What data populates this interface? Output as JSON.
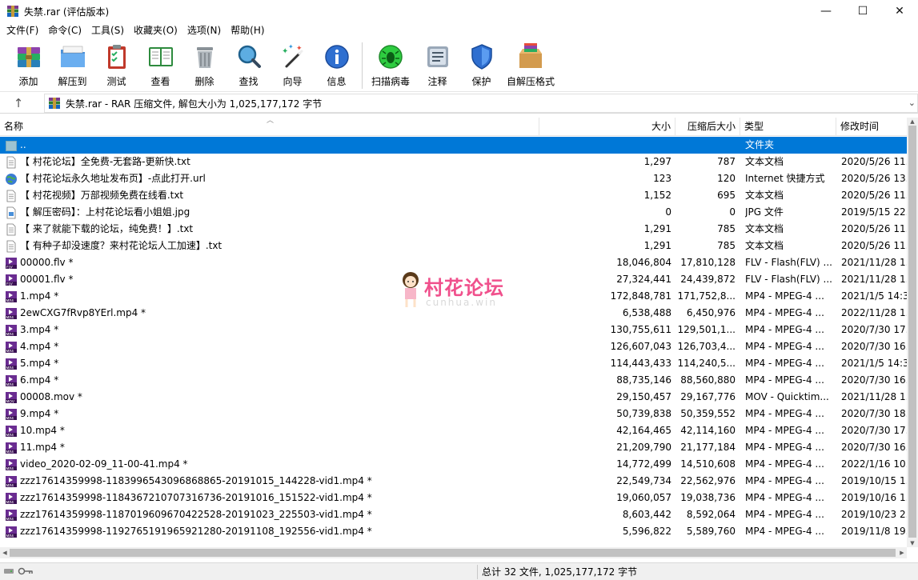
{
  "window": {
    "title": "失禁.rar (评估版本)",
    "minimize": "—",
    "maximize": "☐",
    "close": "✕"
  },
  "menu": [
    "文件(F)",
    "命令(C)",
    "工具(S)",
    "收藏夹(O)",
    "选项(N)",
    "帮助(H)"
  ],
  "toolbar": {
    "add": "添加",
    "extract_to": "解压到",
    "test": "测试",
    "view": "查看",
    "delete": "删除",
    "find": "查找",
    "wizard": "向导",
    "info": "信息",
    "virus_scan": "扫描病毒",
    "comment": "注释",
    "protect": "保护",
    "sfx": "自解压格式"
  },
  "address": {
    "text": "失禁.rar - RAR 压缩文件, 解包大小为 1,025,177,172 字节"
  },
  "columns": {
    "name": "名称",
    "size": "大小",
    "packed": "压缩后大小",
    "type": "类型",
    "modified": "修改时间"
  },
  "rows": [
    {
      "name": "..",
      "size": "",
      "packed": "",
      "type": "文件夹",
      "modified": "",
      "icon": "folder-up-icon"
    },
    {
      "name": "【 村花论坛】全免费-无套路-更新快.txt",
      "size": "1,297",
      "packed": "787",
      "type": "文本文档",
      "modified": "2020/5/26 11.",
      "icon": "text-file-icon"
    },
    {
      "name": "【 村花论坛永久地址发布页】-点此打开.url",
      "size": "123",
      "packed": "120",
      "type": "Internet 快捷方式",
      "modified": "2020/5/26 13.",
      "icon": "url-globe-icon"
    },
    {
      "name": "【 村花视频】万部视频免费在线看.txt",
      "size": "1,152",
      "packed": "695",
      "type": "文本文档",
      "modified": "2020/5/26 11.",
      "icon": "text-file-icon"
    },
    {
      "name": "【 解压密码】：上村花论坛看小姐姐.jpg",
      "size": "0",
      "packed": "0",
      "type": "JPG 文件",
      "modified": "2019/5/15 22.",
      "icon": "image-file-icon"
    },
    {
      "name": "【 来了就能下载的论坛，纯免费！】.txt",
      "size": "1,291",
      "packed": "785",
      "type": "文本文档",
      "modified": "2020/5/26 11.",
      "icon": "text-file-icon"
    },
    {
      "name": "【 有种子却没速度？来村花论坛人工加速】.txt",
      "size": "1,291",
      "packed": "785",
      "type": "文本文档",
      "modified": "2020/5/26 11.",
      "icon": "text-file-icon"
    },
    {
      "name": "00000.flv *",
      "size": "18,046,804",
      "packed": "17,810,128",
      "type": "FLV - Flash(FLV) ...",
      "modified": "2021/11/28 1.",
      "icon": "flv-video-icon"
    },
    {
      "name": "00001.flv *",
      "size": "27,324,441",
      "packed": "24,439,872",
      "type": "FLV - Flash(FLV) ...",
      "modified": "2021/11/28 1.",
      "icon": "flv-video-icon"
    },
    {
      "name": "1.mp4 *",
      "size": "172,848,781",
      "packed": "171,752,8...",
      "type": "MP4 - MPEG-4 ...",
      "modified": "2021/1/5 14:3",
      "icon": "mp4-video-icon"
    },
    {
      "name": "2ewCXG7fRvp8YErl.mp4 *",
      "size": "6,538,488",
      "packed": "6,450,976",
      "type": "MP4 - MPEG-4 ...",
      "modified": "2022/11/28 1.",
      "icon": "mp4-video-icon"
    },
    {
      "name": "3.mp4 *",
      "size": "130,755,611",
      "packed": "129,501,1...",
      "type": "MP4 - MPEG-4 ...",
      "modified": "2020/7/30 17.",
      "icon": "mp4-video-icon"
    },
    {
      "name": "4.mp4 *",
      "size": "126,607,043",
      "packed": "126,703,4...",
      "type": "MP4 - MPEG-4 ...",
      "modified": "2020/7/30 16.",
      "icon": "mp4-video-icon"
    },
    {
      "name": "5.mp4 *",
      "size": "114,443,433",
      "packed": "114,240,5...",
      "type": "MP4 - MPEG-4 ...",
      "modified": "2021/1/5 14:3",
      "icon": "mp4-video-icon"
    },
    {
      "name": "6.mp4 *",
      "size": "88,735,146",
      "packed": "88,560,880",
      "type": "MP4 - MPEG-4 ...",
      "modified": "2020/7/30 16.",
      "icon": "mp4-video-icon"
    },
    {
      "name": "00008.mov *",
      "size": "29,150,457",
      "packed": "29,167,776",
      "type": "MOV - Quicktim...",
      "modified": "2021/11/28 1.",
      "icon": "mov-video-icon"
    },
    {
      "name": "9.mp4 *",
      "size": "50,739,838",
      "packed": "50,359,552",
      "type": "MP4 - MPEG-4 ...",
      "modified": "2020/7/30 18.",
      "icon": "mp4-video-icon"
    },
    {
      "name": "10.mp4 *",
      "size": "42,164,465",
      "packed": "42,114,160",
      "type": "MP4 - MPEG-4 ...",
      "modified": "2020/7/30 17.",
      "icon": "mp4-video-icon"
    },
    {
      "name": "11.mp4 *",
      "size": "21,209,790",
      "packed": "21,177,184",
      "type": "MP4 - MPEG-4 ...",
      "modified": "2020/7/30 16.",
      "icon": "mp4-video-icon"
    },
    {
      "name": "video_2020-02-09_11-00-41.mp4 *",
      "size": "14,772,499",
      "packed": "14,510,608",
      "type": "MP4 - MPEG-4 ...",
      "modified": "2022/1/16 10.",
      "icon": "mp4-video-icon"
    },
    {
      "name": "zzz17614359998-1183996543096868865-20191015_144228-vid1.mp4 *",
      "size": "22,549,734",
      "packed": "22,562,976",
      "type": "MP4 - MPEG-4 ...",
      "modified": "2019/10/15 1.",
      "icon": "mp4-video-icon"
    },
    {
      "name": "zzz17614359998-1184367210707316736-20191016_151522-vid1.mp4 *",
      "size": "19,060,057",
      "packed": "19,038,736",
      "type": "MP4 - MPEG-4 ...",
      "modified": "2019/10/16 1.",
      "icon": "mp4-video-icon"
    },
    {
      "name": "zzz17614359998-1187019609670422528-20191023_225503-vid1.mp4 *",
      "size": "8,603,442",
      "packed": "8,592,064",
      "type": "MP4 - MPEG-4 ...",
      "modified": "2019/10/23 2.",
      "icon": "mp4-video-icon"
    },
    {
      "name": "zzz17614359998-1192765191965921280-20191108_192556-vid1.mp4 *",
      "size": "5,596,822",
      "packed": "5,589,760",
      "type": "MP4 - MPEG-4 ...",
      "modified": "2019/11/8 19.",
      "icon": "mp4-video-icon"
    }
  ],
  "watermark": {
    "text": "村花论坛",
    "sub": "cunhua.win"
  },
  "status": {
    "summary": "总计 32 文件, 1,025,177,172 字节"
  },
  "colors": {
    "selection": "#0078d7",
    "watermark": "#f0508c"
  }
}
